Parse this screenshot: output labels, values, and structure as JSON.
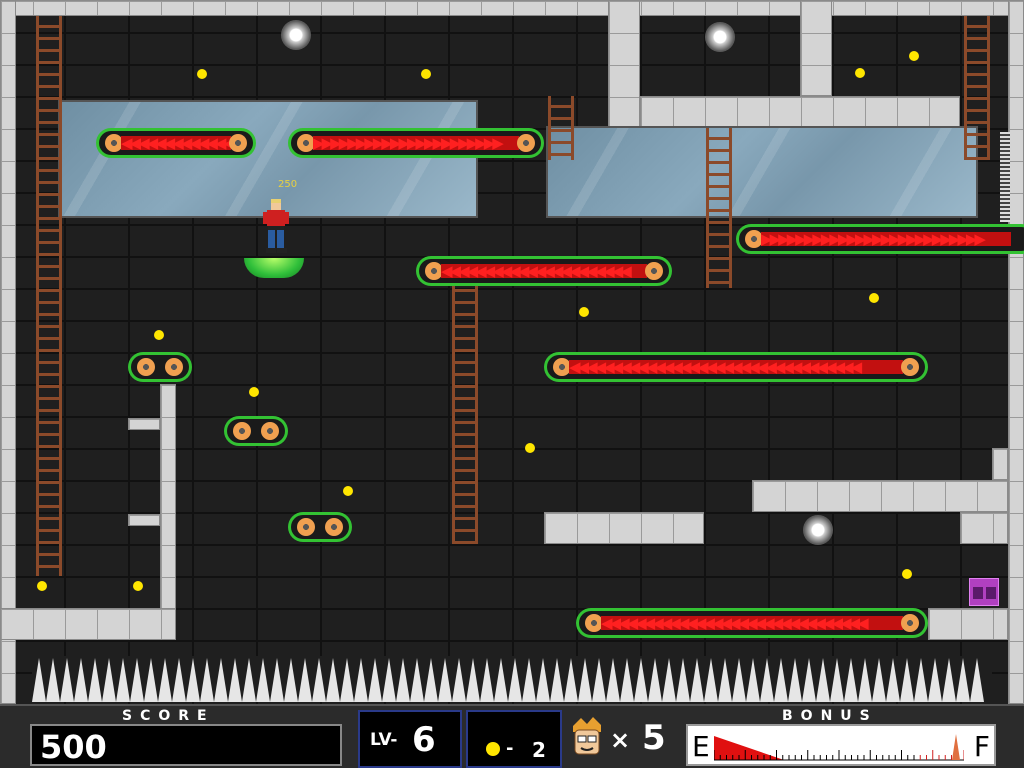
{
  "game": {
    "floating_points": "250"
  },
  "hud": {
    "score_label": "SCORE",
    "score_value": "500",
    "level_prefix": "LV-",
    "level_value": "6",
    "coins_prefix": "-",
    "coins_value": "2",
    "lives_times": "×",
    "lives_value": "5",
    "bonus_label": "BONUS",
    "bonus_empty": "E",
    "bonus_full": "F",
    "bonus_fraction": 0.28
  },
  "colors": {
    "belt_rim": "#33c233",
    "belt_arrow": "#ff2020",
    "coin": "#ffe600",
    "bonus_fill": "#e01010"
  },
  "icons": {
    "coin_icon": "yellow-circle",
    "lives_icon": "player-face",
    "exit_icon": "purple-terminal"
  }
}
